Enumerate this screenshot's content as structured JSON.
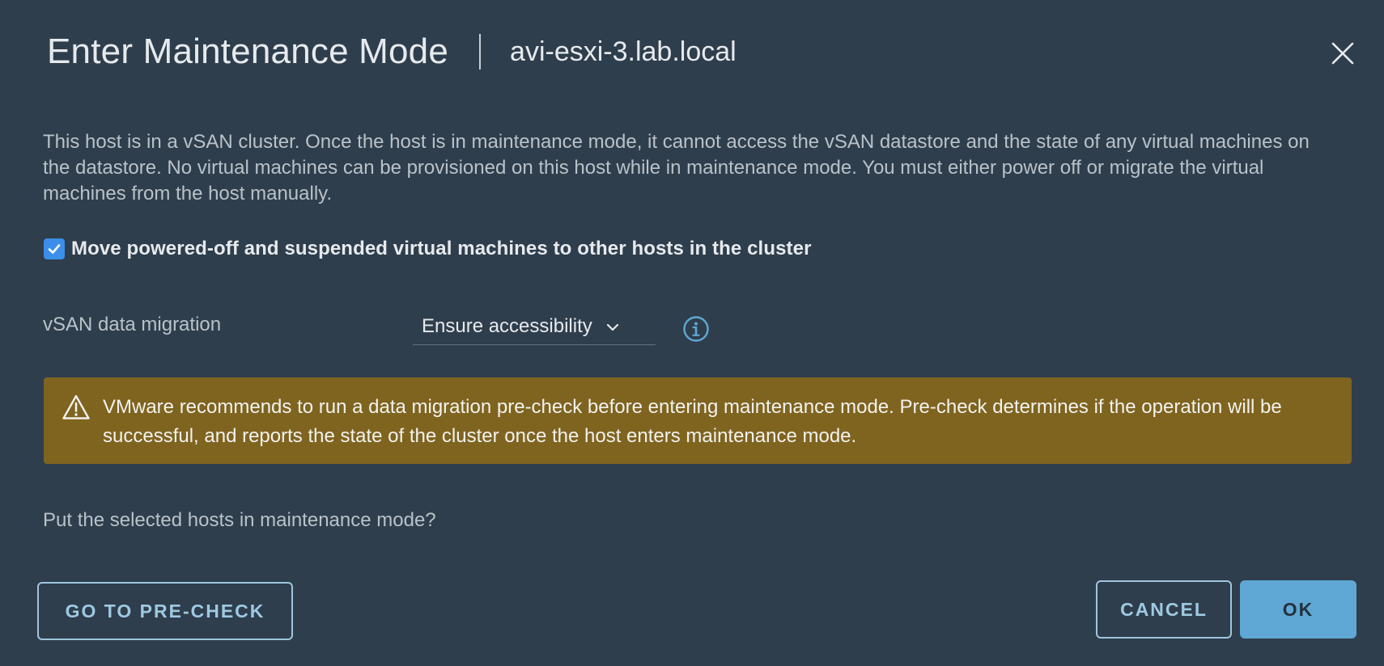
{
  "dialog": {
    "title": "Enter Maintenance Mode",
    "host": "avi-esxi-3.lab.local",
    "close_icon": "close-icon"
  },
  "body": {
    "description": "This host is in a vSAN cluster. Once the host is in maintenance mode, it cannot access the vSAN datastore and the state of any virtual machines on the datastore. No virtual machines can be provisioned on this host while in maintenance mode. You must either power off or migrate the virtual machines from the host manually.",
    "move_vms": {
      "label": "Move powered-off and suspended virtual machines to other hosts in the cluster",
      "checked": true
    },
    "vsan_migration": {
      "label": "vSAN data migration",
      "value": "Ensure accessibility",
      "icon": "info-icon"
    },
    "alert": {
      "icon": "warning-icon",
      "text": "VMware recommends to run a data migration pre-check before entering maintenance mode. Pre-check determines if the operation will be successful, and reports the state of the cluster once the host enters maintenance mode."
    },
    "question": "Put the selected hosts in maintenance mode?"
  },
  "footer": {
    "precheck_label": "GO TO PRE-CHECK",
    "cancel_label": "CANCEL",
    "ok_label": "OK"
  },
  "colors": {
    "background": "#2f3e4c",
    "alert_bg": "#7f6420",
    "accent": "#5fa7d4",
    "checkbox": "#3b8ee9"
  }
}
